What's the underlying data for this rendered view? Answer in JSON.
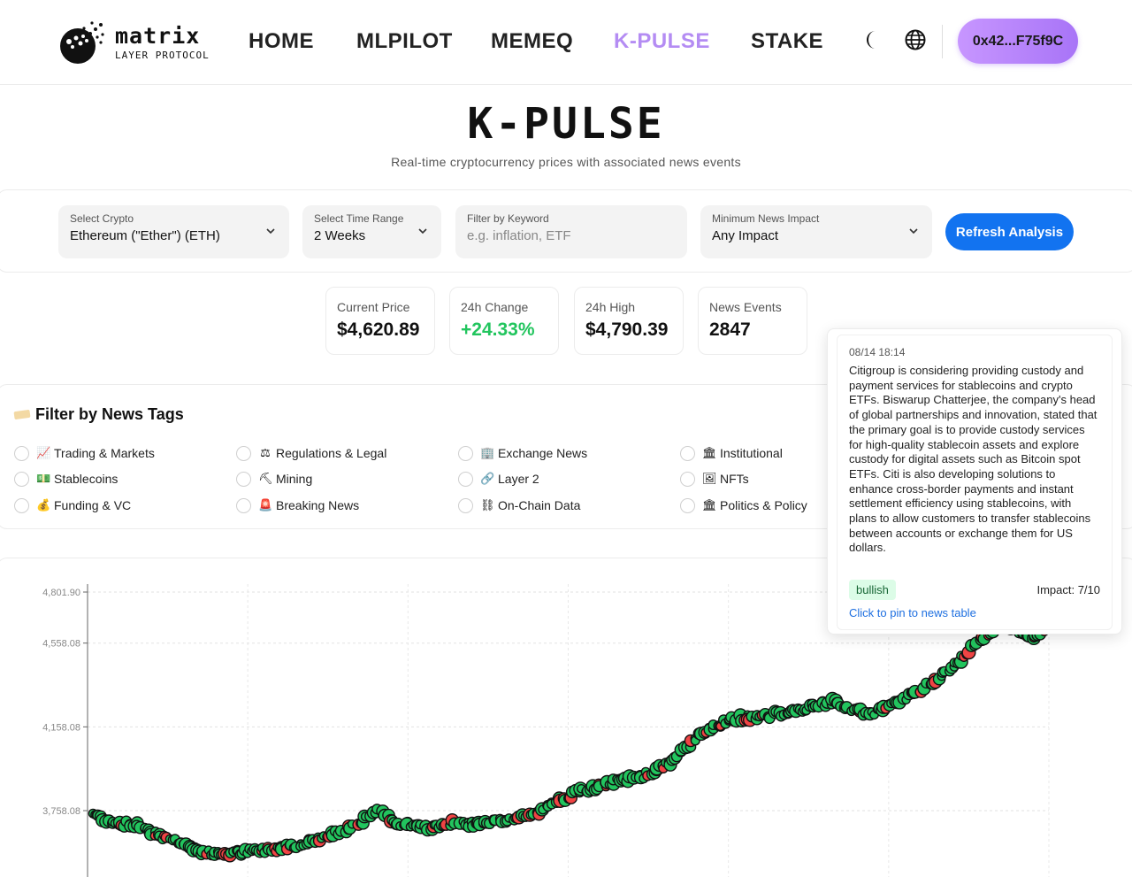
{
  "brand": {
    "name": "matrix",
    "subtitle": "LAYER PROTOCOL"
  },
  "nav": {
    "items": [
      {
        "label": "HOME"
      },
      {
        "label": "MLPILOT"
      },
      {
        "label": "MEMEQ"
      },
      {
        "label": "K-PULSE",
        "active": true
      },
      {
        "label": "STAKE"
      }
    ],
    "active_color": "#b48cf3",
    "theme_icon": "moon-icon",
    "language_icon": "globe-icon"
  },
  "wallet": {
    "address": "0x42...F75f9C"
  },
  "page": {
    "title": "K-PULSE",
    "subtitle": "Real-time cryptocurrency prices with associated news events"
  },
  "filters": {
    "crypto": {
      "label": "Select Crypto",
      "value": "Ethereum (\"Ether\") (ETH)"
    },
    "time_range": {
      "label": "Select Time Range",
      "value": "2 Weeks"
    },
    "keyword": {
      "label": "Filter by Keyword",
      "placeholder": "e.g. inflation, ETF",
      "value": ""
    },
    "impact": {
      "label": "Minimum News Impact",
      "value": "Any Impact"
    },
    "refresh_label": "Refresh Analysis"
  },
  "stats": [
    {
      "label": "Current Price",
      "value": "$4,620.89"
    },
    {
      "label": "24h Change",
      "value": "+24.33%"
    },
    {
      "label": "24h High",
      "value": "$4,790.39"
    },
    {
      "label": "News Events",
      "value": "2847"
    }
  ],
  "tags": {
    "title": "Filter by News Tags",
    "items": [
      {
        "emoji": "📈",
        "label": "Trading & Markets"
      },
      {
        "emoji": "💵",
        "label": "Stablecoins"
      },
      {
        "emoji": "💰",
        "label": "Funding & VC"
      },
      {
        "emoji": "⚖",
        "label": "Regulations & Legal"
      },
      {
        "emoji": "⛏",
        "label": "Mining"
      },
      {
        "emoji": "🚨",
        "label": "Breaking News"
      },
      {
        "emoji": "🏢",
        "label": "Exchange News"
      },
      {
        "emoji": "🔗",
        "label": "Layer 2"
      },
      {
        "emoji": "⛓",
        "label": "On-Chain Data"
      },
      {
        "emoji": "🏛",
        "label": "Institutional"
      },
      {
        "emoji": "🖼",
        "label": "NFTs"
      },
      {
        "emoji": "🏛",
        "label": "Politics & Policy"
      }
    ]
  },
  "tooltip": {
    "date": "08/14 18:14",
    "text": "Citigroup is considering providing custody and payment services for stablecoins and crypto ETFs. Biswarup Chatterjee, the company's head of global partnerships and innovation, stated that the primary goal is to provide custody services for high-quality stablecoin assets and explore custody for digital assets such as Bitcoin spot ETFs. Citi is also developing solutions to enhance cross-border payments and instant settlement efficiency using stablecoins, with plans to allow customers to transfer stablecoins between accounts or exchange them for US dollars.",
    "sentiment": "bullish",
    "impact": "Impact: 7/10",
    "pin_label": "Click to pin to news table"
  },
  "chart_data": {
    "type": "scatter",
    "title": "",
    "xlabel": "",
    "ylabel": "",
    "yticks": [
      "4,801.90",
      "4,558.08",
      "4,158.08",
      "3,758.08"
    ],
    "ytick_values": [
      4801.9,
      4558.08,
      4158.08,
      3758.08
    ],
    "ylim": [
      3500,
      4830
    ],
    "grid": true,
    "colors": {
      "bullish": "#22c55e",
      "bearish": "#ef4444",
      "outline": "#111111"
    },
    "price_path": [
      [
        0.0,
        3745
      ],
      [
        0.02,
        3705
      ],
      [
        0.05,
        3685
      ],
      [
        0.07,
        3640
      ],
      [
        0.09,
        3610
      ],
      [
        0.11,
        3565
      ],
      [
        0.13,
        3550
      ],
      [
        0.16,
        3560
      ],
      [
        0.19,
        3575
      ],
      [
        0.22,
        3600
      ],
      [
        0.25,
        3640
      ],
      [
        0.28,
        3700
      ],
      [
        0.3,
        3755
      ],
      [
        0.32,
        3700
      ],
      [
        0.35,
        3675
      ],
      [
        0.38,
        3700
      ],
      [
        0.41,
        3690
      ],
      [
        0.44,
        3720
      ],
      [
        0.47,
        3750
      ],
      [
        0.49,
        3810
      ],
      [
        0.52,
        3860
      ],
      [
        0.55,
        3895
      ],
      [
        0.58,
        3925
      ],
      [
        0.61,
        3990
      ],
      [
        0.63,
        4085
      ],
      [
        0.65,
        4160
      ],
      [
        0.68,
        4200
      ],
      [
        0.71,
        4210
      ],
      [
        0.73,
        4225
      ],
      [
        0.76,
        4255
      ],
      [
        0.78,
        4280
      ],
      [
        0.8,
        4240
      ],
      [
        0.82,
        4215
      ],
      [
        0.84,
        4260
      ],
      [
        0.86,
        4310
      ],
      [
        0.88,
        4360
      ],
      [
        0.9,
        4420
      ],
      [
        0.92,
        4520
      ],
      [
        0.94,
        4600
      ],
      [
        0.96,
        4665
      ],
      [
        0.975,
        4610
      ],
      [
        0.99,
        4590
      ],
      [
        1.0,
        4620
      ]
    ],
    "x_range": [
      0,
      1
    ]
  }
}
